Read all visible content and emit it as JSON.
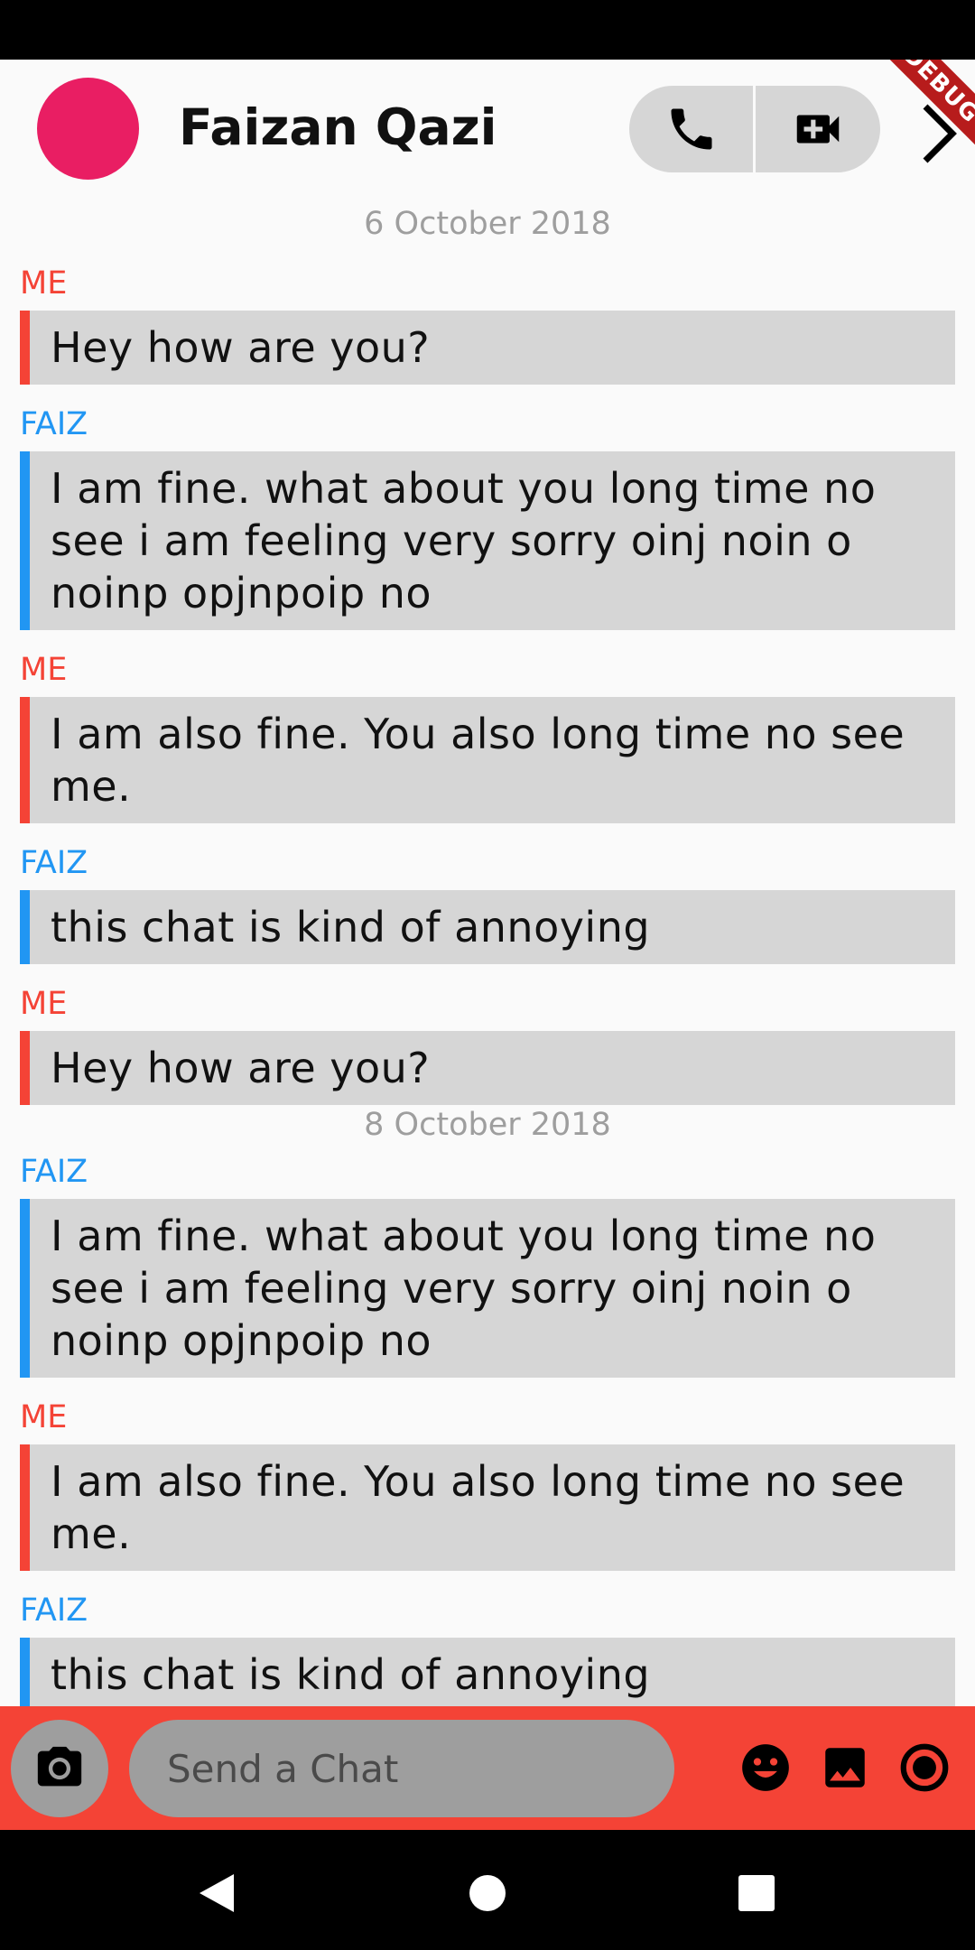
{
  "header": {
    "contact_name": "Faizan Qazi",
    "avatar_color": "#e91e63",
    "debug_banner": "DEBUG"
  },
  "colors": {
    "me": "#f44336",
    "faiz": "#2196f3",
    "bubble": "#d6d6d6",
    "bottom_bar": "#f44336"
  },
  "messages": [
    {
      "date": "6 October 2018"
    },
    {
      "sender": "ME",
      "side": "me",
      "text": "Hey how are you?"
    },
    {
      "sender": "FAIZ",
      "side": "faiz",
      "text": "I am fine. what about you long time no see i am feeling very sorry oinj noin o noinp opjnpoip no"
    },
    {
      "sender": "ME",
      "side": "me",
      "text": "I am also fine. You also long time no see me."
    },
    {
      "sender": "FAIZ",
      "side": "faiz",
      "text": "this chat is kind of annoying"
    },
    {
      "sender": "ME",
      "side": "me",
      "text": "Hey how are you?"
    },
    {
      "date": "8 October 2018"
    },
    {
      "sender": "FAIZ",
      "side": "faiz",
      "text": "I am fine. what about you long time no see i am feeling very sorry oinj noin o noinp opjnpoip no"
    },
    {
      "sender": "ME",
      "side": "me",
      "text": "I am also fine. You also long time no see me."
    },
    {
      "sender": "FAIZ",
      "side": "faiz",
      "text": "this chat is kind of annoying"
    }
  ],
  "composer": {
    "placeholder": "Send a Chat",
    "icons": [
      "camera-icon",
      "emoji-icon",
      "image-icon",
      "record-icon"
    ]
  },
  "nav": {
    "icons": [
      "back-icon",
      "home-icon",
      "recents-icon"
    ]
  }
}
